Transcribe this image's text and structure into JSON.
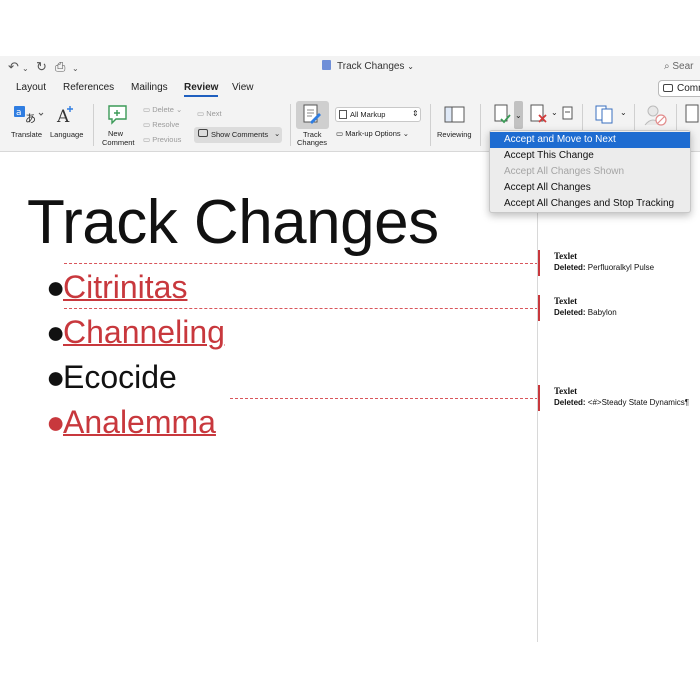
{
  "titlebar": {
    "doc_title": "Track Changes",
    "search_text": "Sear"
  },
  "tabs": [
    {
      "label": "Layout"
    },
    {
      "label": "References"
    },
    {
      "label": "Mailings"
    },
    {
      "label": "Review"
    },
    {
      "label": "View"
    }
  ],
  "comments_button": "Comm",
  "ribbon": {
    "translate": "Translate",
    "language": "Language",
    "new_comment_line1": "New",
    "new_comment_line2": "Comment",
    "delete": "Delete",
    "resolve": "Resolve",
    "previous": "Previous",
    "next": "Next",
    "show_comments": "Show Comments",
    "track_changes_line1": "Track",
    "track_changes_line2": "Changes",
    "markup_select": "All Markup",
    "markup_options": "Mark-up Options",
    "reviewing": "Reviewing"
  },
  "accept_menu": [
    {
      "label": "Accept and Move to Next",
      "state": "highlighted"
    },
    {
      "label": "Accept This Change",
      "state": "normal"
    },
    {
      "label": "Accept All Changes Shown",
      "state": "disabled"
    },
    {
      "label": "Accept All Changes",
      "state": "normal"
    },
    {
      "label": "Accept All Changes and Stop Tracking",
      "state": "normal"
    }
  ],
  "document": {
    "heading": "Track Changes",
    "bullet": "●",
    "items": [
      {
        "text": "Citrinitas",
        "status": "deleted"
      },
      {
        "text": "Channeling",
        "status": "deleted"
      },
      {
        "text": "Ecocide",
        "status": "normal"
      },
      {
        "text": "Analemma",
        "status": "deleted"
      }
    ]
  },
  "balloons": [
    {
      "author": "Texlet",
      "prefix": "Deleted:",
      "text": "Perfluoralkyl Pulse"
    },
    {
      "author": "Texlet",
      "prefix": "Deleted:",
      "text": "Babylon"
    },
    {
      "author": "Texlet",
      "prefix": "Deleted:",
      "text": "<#>Steady State Dynamics¶"
    }
  ],
  "colors": {
    "revision_red": "#c8383d",
    "menu_highlight": "#1e6cd1",
    "review_tab_underline": "#1f5fbf"
  }
}
